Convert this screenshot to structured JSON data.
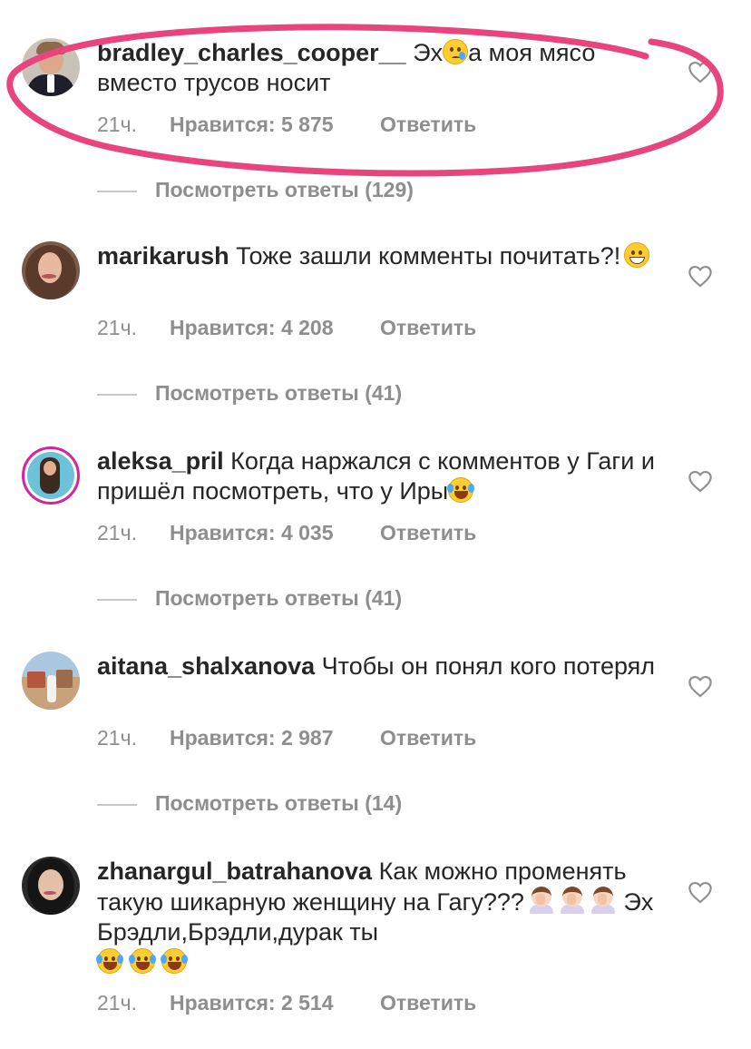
{
  "comments": [
    {
      "username": "bradley_charles_cooper__",
      "text_before_emoji": " Эх",
      "emoji_1": "crying-face",
      "text_after_emoji": "а моя мясо вместо трусов носит",
      "time": "21ч.",
      "likes": "Нравится: 5 875",
      "reply": "Ответить",
      "view_replies": "Посмотреть ответы (129)"
    },
    {
      "username": "marikarush",
      "text": " Тоже зашли комменты почитать?!",
      "emoji_1": "grinning-face",
      "time": "21ч.",
      "likes": "Нравится: 4 208",
      "reply": "Ответить",
      "view_replies": "Посмотреть ответы (41)"
    },
    {
      "username": "aleksa_pril",
      "text": " Когда наржался с комментов у Гаги и пришёл посмотреть, что у Иры",
      "emoji_1": "tears-of-joy",
      "time": "21ч.",
      "likes": "Нравится: 4 035",
      "reply": "Ответить",
      "view_replies": "Посмотреть ответы (41)"
    },
    {
      "username": "aitana_shalxanova",
      "text": " Чтобы он понял кого потерял",
      "time": "21ч.",
      "likes": "Нравится: 2 987",
      "reply": "Ответить",
      "view_replies": "Посмотреть ответы (14)"
    },
    {
      "username": "zhanargul_batrahanova",
      "text_part_1": " Как можно променять такую шикарную женщину на Гагу???",
      "emoji_facepalm": "facepalm",
      "text_part_2": " Эх Брэдли,Брэдли,дурак ты",
      "emoji_laugh": "tears-of-joy",
      "time": "21ч.",
      "likes": "Нравится: 2 514",
      "reply": "Ответить"
    }
  ],
  "colors": {
    "annotation": "#e8457e",
    "text": "#262626",
    "muted": "#8e8e8e",
    "divider": "#c7c7c7"
  },
  "icons": {
    "like": "heart-outline-icon"
  }
}
